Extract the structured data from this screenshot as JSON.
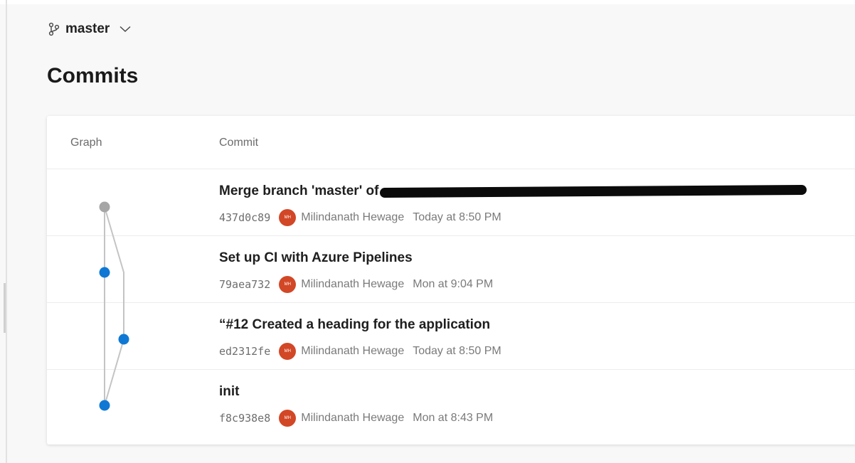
{
  "branch": {
    "icon": "branch-icon",
    "name": "master",
    "dropdown_icon": "chevron-down-icon"
  },
  "page": {
    "title": "Commits"
  },
  "table": {
    "columns": [
      "Graph",
      "Commit"
    ],
    "commits": [
      {
        "message": "Merge branch 'master' of",
        "redacted": true,
        "hash": "437d0c89",
        "avatar_initials": "MH",
        "author": "Milindanath Hewage",
        "date": "Today at 8:50 PM"
      },
      {
        "message": "Set up CI with Azure Pipelines",
        "redacted": false,
        "hash": "79aea732",
        "avatar_initials": "MH",
        "author": "Milindanath Hewage",
        "date": "Mon at 9:04 PM"
      },
      {
        "message": "“#12 Created a heading for the application",
        "redacted": false,
        "hash": "ed2312fe",
        "avatar_initials": "MH",
        "author": "Milindanath Hewage",
        "date": "Today at 8:50 PM"
      },
      {
        "message": "init",
        "redacted": false,
        "hash": "f8c938e8",
        "avatar_initials": "MH",
        "author": "Milindanath Hewage",
        "date": "Mon at 8:43 PM"
      }
    ]
  },
  "colors": {
    "node_merge": "#a6a6a6",
    "node_commit": "#0f78d4",
    "edge": "#c4c4c4",
    "avatar": "#d24726"
  }
}
